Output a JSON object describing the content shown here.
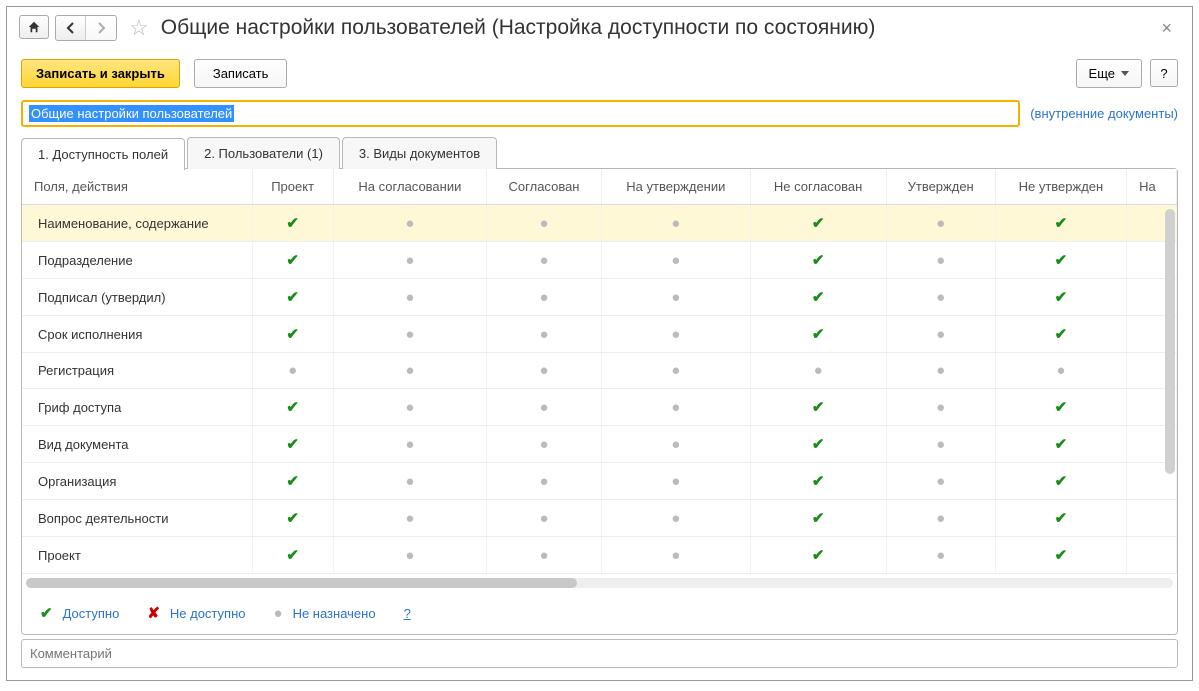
{
  "header": {
    "title": "Общие настройки пользователей (Настройка доступности по состоянию)"
  },
  "toolbar": {
    "save_close": "Записать и закрыть",
    "save": "Записать",
    "more": "Еще",
    "help": "?"
  },
  "name_field": {
    "value": "Общие настройки пользователей",
    "link": "(внутренние документы)"
  },
  "tabs": [
    {
      "label": "1. Доступность полей"
    },
    {
      "label": "2. Пользователи (1)"
    },
    {
      "label": "3. Виды документов"
    }
  ],
  "table": {
    "columns": [
      "Поля, действия",
      "Проект",
      "На согласовании",
      "Согласован",
      "На утверждении",
      "Не согласован",
      "Утвержден",
      "Не утвержден",
      "На"
    ],
    "rows": [
      {
        "label": "Наименование, содержание",
        "cells": [
          "chk",
          "dot",
          "dot",
          "dot",
          "chk",
          "dot",
          "chk"
        ],
        "selected": true
      },
      {
        "label": "Подразделение",
        "cells": [
          "chk",
          "dot",
          "dot",
          "dot",
          "chk",
          "dot",
          "chk"
        ]
      },
      {
        "label": "Подписал (утвердил)",
        "cells": [
          "chk",
          "dot",
          "dot",
          "dot",
          "chk",
          "dot",
          "chk"
        ]
      },
      {
        "label": "Срок исполнения",
        "cells": [
          "chk",
          "dot",
          "dot",
          "dot",
          "chk",
          "dot",
          "chk"
        ]
      },
      {
        "label": "Регистрация",
        "cells": [
          "dot",
          "dot",
          "dot",
          "dot",
          "dot",
          "dot",
          "dot"
        ]
      },
      {
        "label": "Гриф доступа",
        "cells": [
          "chk",
          "dot",
          "dot",
          "dot",
          "chk",
          "dot",
          "chk"
        ]
      },
      {
        "label": "Вид документа",
        "cells": [
          "chk",
          "dot",
          "dot",
          "dot",
          "chk",
          "dot",
          "chk"
        ]
      },
      {
        "label": "Организация",
        "cells": [
          "chk",
          "dot",
          "dot",
          "dot",
          "chk",
          "dot",
          "chk"
        ]
      },
      {
        "label": "Вопрос деятельности",
        "cells": [
          "chk",
          "dot",
          "dot",
          "dot",
          "chk",
          "dot",
          "chk"
        ]
      },
      {
        "label": "Проект",
        "cells": [
          "chk",
          "dot",
          "dot",
          "dot",
          "chk",
          "dot",
          "chk"
        ]
      }
    ]
  },
  "legend": {
    "available": "Доступно",
    "unavailable": "Не доступно",
    "unassigned": "Не назначено",
    "help": "?"
  },
  "comment": {
    "placeholder": "Комментарий"
  }
}
